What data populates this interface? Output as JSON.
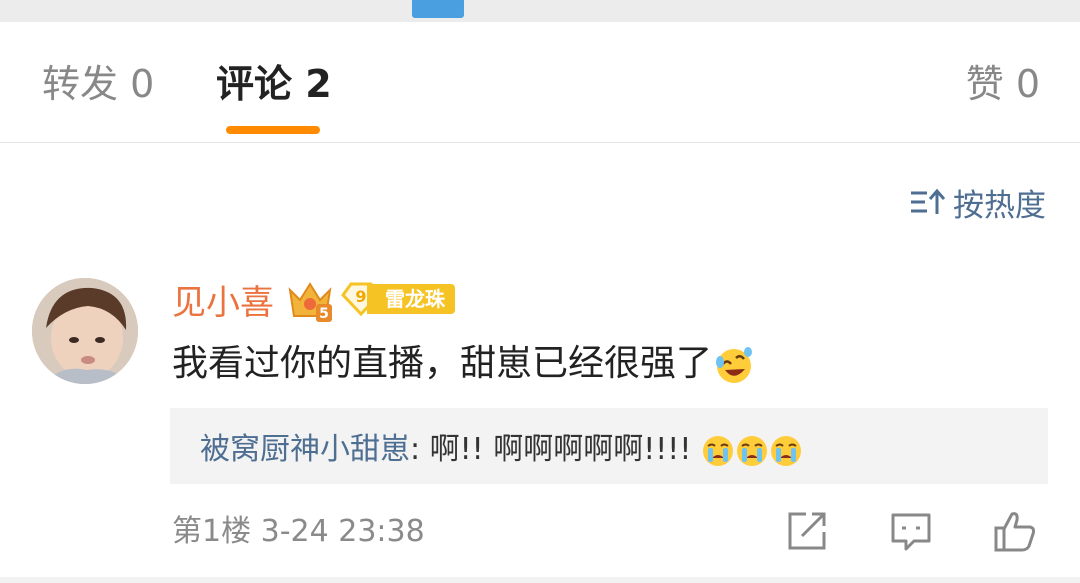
{
  "tabs": {
    "repost": "转发 0",
    "comment": "评论 2",
    "like": "赞 0"
  },
  "sort": {
    "label": "按热度",
    "icon": "sort-icon"
  },
  "comment": {
    "username": "见小喜",
    "crown_level": "5",
    "level_number": "9",
    "level_tag": "雷龙珠",
    "text": "我看过你的直播，甜崽已经很强了",
    "text_emoji": "laugh-cry-emoji",
    "reply": {
      "name": "被窝厨神小甜崽",
      "colon": ": ",
      "content": "啊!! 啊啊啊啊啊!!!! ",
      "emojis": [
        "crying-emoji",
        "crying-emoji",
        "crying-emoji"
      ]
    },
    "meta": "第1楼 3-24 23:38"
  },
  "actions": [
    "share-icon",
    "comment-icon",
    "like-icon"
  ],
  "colors": {
    "accent": "#ff8a00",
    "username": "#eb7340",
    "link": "#4e6e92",
    "badge": "#f6c324"
  }
}
